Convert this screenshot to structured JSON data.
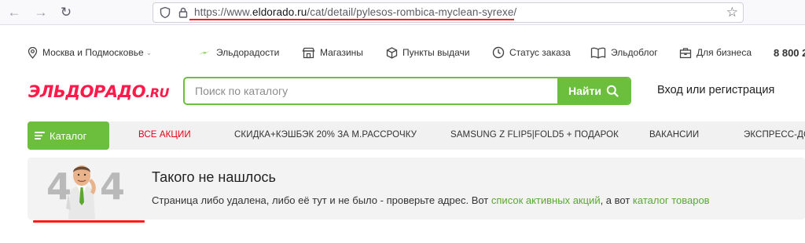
{
  "browser": {
    "url_prefix": "https://www.",
    "url_host": "eldorado.ru",
    "url_path": "/cat/detail/pylesos-rombica-myclean-syrexe/"
  },
  "topbar": {
    "region": "Москва и Подмосковье",
    "items": [
      "Эльдорадости",
      "Магазины",
      "Пункты выдачи",
      "Статус заказа",
      "Эльдоблог",
      "Для бизнеса"
    ],
    "phone": "8 800 2"
  },
  "header": {
    "logo_main": "ЭЛЬДОРАДО",
    "logo_suffix": ".RU",
    "search_placeholder": "Поиск по каталогу",
    "search_button": "Найти",
    "login": "Вход или регистрация"
  },
  "catbar": {
    "catalog_label": "Каталог",
    "links": [
      "Все акции",
      "Скидка+кэшбэк 20% за м.Рассрочку",
      "Samsung Z Flip5|Fold5 + подарок",
      "Вакансии",
      "Экспресс-дос"
    ]
  },
  "notfound": {
    "code_left": "4",
    "code_right": "4",
    "title": "Такого не нашлось",
    "text_before": "Страница либо удалена, либо её тут и не было - проверьте адрес. Вот ",
    "link_promos": "список активных акций",
    "text_middle": ", а вот ",
    "link_catalog": "каталог товаров"
  },
  "colors": {
    "brand_green": "#6cbf3d",
    "brand_red": "#ff1a4a",
    "promo_red": "#e3001b",
    "link_green": "#5aa832",
    "annotation_red": "#ff1a1a"
  },
  "icons": [
    "arrow-left-icon",
    "arrow-right-icon",
    "reload-icon",
    "shield-icon",
    "lock-icon",
    "star-icon",
    "location-pin-icon",
    "lightning-icon",
    "store-icon",
    "box-icon",
    "clock-icon",
    "book-icon",
    "briefcase-icon",
    "search-icon",
    "menu-icon"
  ]
}
